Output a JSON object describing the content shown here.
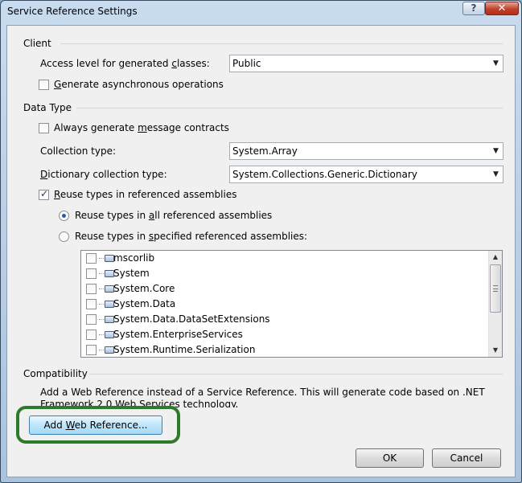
{
  "window": {
    "title": "Service Reference Settings",
    "help_label": "?",
    "close_label": "✕"
  },
  "client": {
    "group_label": "Client",
    "access_level_label_pre": "Access level for generated ",
    "access_level_label_key": "c",
    "access_level_label_post": "lasses:",
    "access_level_value": "Public",
    "async_label_key": "G",
    "async_label_post": "enerate asynchronous operations",
    "async_checked": false
  },
  "data_type": {
    "group_label": "Data Type",
    "message_contracts_label_pre": "Always generate ",
    "message_contracts_label_key": "m",
    "message_contracts_label_post": "essage contracts",
    "message_contracts_checked": false,
    "collection_label_pre": "Collection type:",
    "collection_value": "System.Array",
    "dictionary_label_key": "D",
    "dictionary_label_post": "ictionary collection type:",
    "dictionary_value": "System.Collections.Generic.Dictionary",
    "reuse_label_key": "R",
    "reuse_label_post": "euse types in referenced assemblies",
    "reuse_checked": true,
    "reuse_all_label_pre": "Reuse types in ",
    "reuse_all_label_key": "a",
    "reuse_all_label_post": "ll referenced assemblies",
    "reuse_all_selected": true,
    "reuse_specified_label_pre": "Reuse types in ",
    "reuse_specified_label_key": "s",
    "reuse_specified_label_post": "pecified referenced assemblies:",
    "reuse_specified_selected": false,
    "assemblies": [
      "mscorlib",
      "System",
      "System.Core",
      "System.Data",
      "System.Data.DataSetExtensions",
      "System.EnterpriseServices",
      "System.Runtime.Serialization"
    ]
  },
  "compatibility": {
    "group_label": "Compatibility",
    "description": "Add a Web Reference instead of a Service Reference. This will generate code based on .NET Framework 2.0 Web Services technology.",
    "add_web_ref_pre": "Add ",
    "add_web_ref_key": "W",
    "add_web_ref_post": "eb Reference..."
  },
  "footer": {
    "ok_label": "OK",
    "cancel_label": "Cancel"
  },
  "colors": {
    "highlight_ring": "#2f7a2a",
    "close_button": "#c2402a"
  }
}
